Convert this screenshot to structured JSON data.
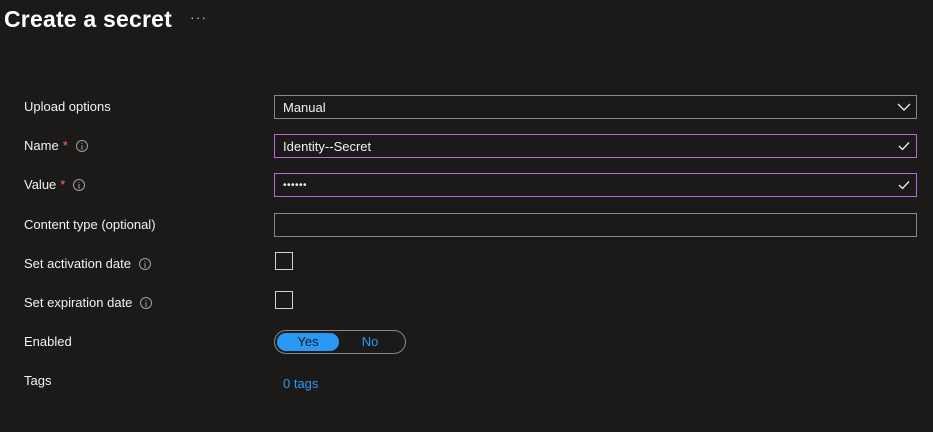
{
  "page": {
    "title": "Create a secret",
    "more_label": "···"
  },
  "form": {
    "upload_options": {
      "label": "Upload options",
      "value": "Manual"
    },
    "name": {
      "label": "Name",
      "required_mark": "*",
      "value": "Identity--Secret"
    },
    "value": {
      "label": "Value",
      "required_mark": "*",
      "value": "••••••"
    },
    "content_type": {
      "label": "Content type (optional)",
      "value": ""
    },
    "activation_date": {
      "label": "Set activation date",
      "checked": false
    },
    "expiration_date": {
      "label": "Set expiration date",
      "checked": false
    },
    "enabled": {
      "label": "Enabled",
      "options": [
        "Yes",
        "No"
      ],
      "selected": "Yes"
    },
    "tags": {
      "label": "Tags",
      "link": "0 tags"
    }
  },
  "colors": {
    "background": "#1b1a19",
    "accent": "#2899f5",
    "valid_border": "#b56bd6",
    "required": "#f1707b"
  }
}
